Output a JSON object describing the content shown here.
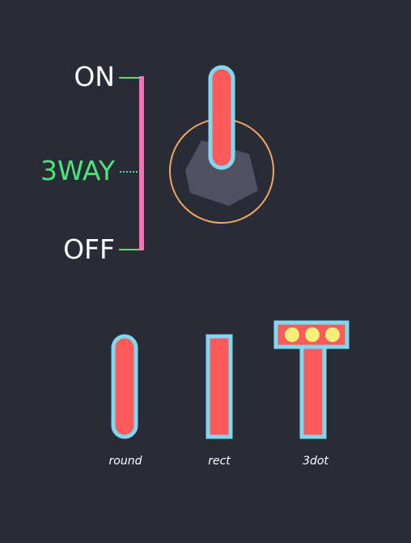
{
  "switch": {
    "positions": {
      "on_label": "ON",
      "three_way_label": "3WAY",
      "off_label": "OFF"
    }
  },
  "styles": {
    "round_label": "round",
    "rect_label": "rect",
    "threedot_label": "3dot"
  },
  "colors": {
    "background": "#292b36",
    "label": "#ffffff",
    "highlight_label": "#4be67a",
    "bracket": "#f472b6",
    "tick": "#4be67a",
    "ring": "#f0a860",
    "hex_nut": "#4f5163",
    "lever_fill": "#ff5a5a",
    "lever_outline": "#7dd8f0",
    "dot": "#f4ee7a"
  }
}
